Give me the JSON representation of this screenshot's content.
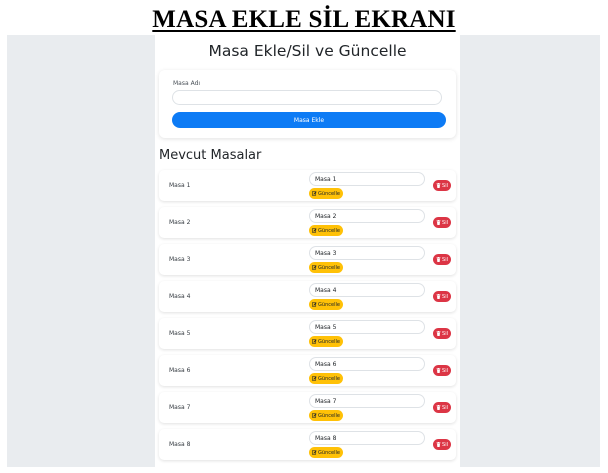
{
  "document": {
    "title": "MASA EKLE SİL EKRANI"
  },
  "app": {
    "title": "Masa Ekle/Sil ve Güncelle",
    "add_form": {
      "label": "Masa Adı",
      "input_value": "",
      "button_label": "Masa Ekle"
    },
    "section_title": "Mevcut Masalar",
    "update_label": "Güncelle",
    "delete_label": "Sil",
    "tables": [
      {
        "name": "Masa 1",
        "input_value": "Masa 1"
      },
      {
        "name": "Masa 2",
        "input_value": "Masa 2"
      },
      {
        "name": "Masa 3",
        "input_value": "Masa 3"
      },
      {
        "name": "Masa 4",
        "input_value": "Masa 4"
      },
      {
        "name": "Masa 5",
        "input_value": "Masa 5"
      },
      {
        "name": "Masa 6",
        "input_value": "Masa 6"
      },
      {
        "name": "Masa 7",
        "input_value": "Masa 7"
      },
      {
        "name": "Masa 8",
        "input_value": "Masa 8"
      }
    ]
  },
  "colors": {
    "primary": "#0d7bf5",
    "warning": "#ffc107",
    "danger": "#dc3545",
    "background": "#e9ecef"
  },
  "icons": {
    "update": "edit-icon",
    "delete": "trash-icon"
  }
}
